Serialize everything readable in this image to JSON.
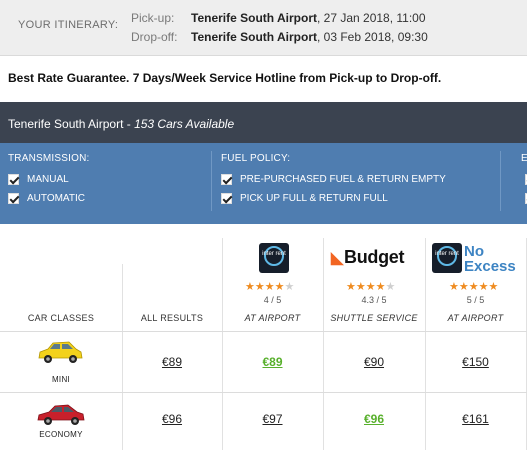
{
  "itinerary": {
    "label": "YOUR ITINERARY:",
    "pickup_key": "Pick-up:",
    "pickup_location": "Tenerife South Airport",
    "pickup_datetime": ", 27 Jan 2018, 11:00",
    "dropoff_key": "Drop-off:",
    "dropoff_location": "Tenerife South Airport",
    "dropoff_datetime": ", 03 Feb 2018, 09:30"
  },
  "guarantee": "Best Rate Guarantee. 7 Days/Week Service Hotline from Pick-up to Drop-off.",
  "results_bar": {
    "location": "Tenerife South Airport",
    "separator": " - ",
    "count": "153 Cars Available"
  },
  "filters": {
    "transmission": {
      "heading": "TRANSMISSION:",
      "options": [
        "MANUAL",
        "AUTOMATIC"
      ]
    },
    "fuel_policy": {
      "heading": "FUEL POLICY:",
      "options": [
        "PRE-PURCHASED FUEL & RETURN EMPTY",
        "PICK UP FULL & RETURN FULL"
      ]
    },
    "third_heading_partial": "E"
  },
  "table": {
    "car_classes_header": "CAR CLASSES",
    "all_results_header": "ALL RESULTS",
    "suppliers": [
      {
        "logo": "interrent-logo",
        "logo_text": "inter rent",
        "stars": 4,
        "rating": "4 / 5",
        "location": "AT AIRPORT"
      },
      {
        "logo": "budget-logo",
        "logo_text": "Budget",
        "stars": 4,
        "rating": "4.3 / 5",
        "location": "SHUTTLE SERVICE"
      },
      {
        "logo": "interrent-no-excess-logo",
        "logo_text": "inter rent",
        "brand_line1": "No",
        "brand_line2": "Excess",
        "stars": 5,
        "rating": "5 / 5",
        "location": "AT AIRPORT"
      }
    ],
    "rows": [
      {
        "class": "MINI",
        "car_color": "#f3d21c",
        "all": "€89",
        "prices": [
          "€89",
          "€90",
          "€150"
        ],
        "best_index": 0
      },
      {
        "class": "ECONOMY",
        "car_color": "#c8202b",
        "all": "€96",
        "prices": [
          "€97",
          "€96",
          "€161"
        ],
        "best_index": 1
      }
    ]
  },
  "colors": {
    "filter_bg": "#4f7db0",
    "results_bar_bg": "#3b4350",
    "best_price": "#58b02c",
    "star": "#ef8b1f"
  }
}
